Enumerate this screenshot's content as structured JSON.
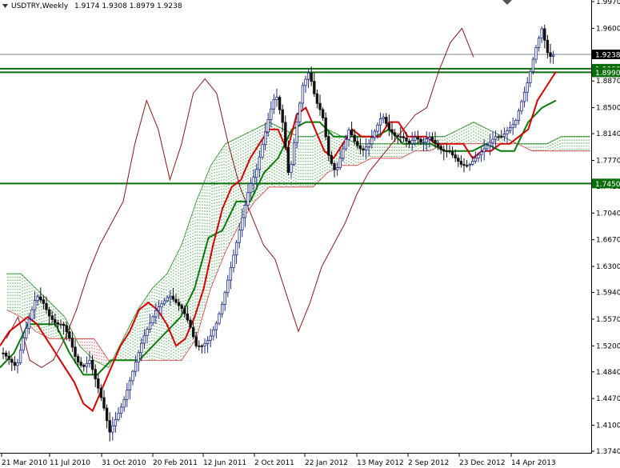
{
  "header": {
    "symbol": "USDTRY,Weekly",
    "ohlc": "1.9174 1.9308 1.8979 1.9238"
  },
  "colors": {
    "candle_up": "#1d2a8a",
    "candle_down": "#111111",
    "tenkan": "#d60000",
    "kijun": "#0a7a0a",
    "chikou": "#8b1a1a",
    "cloud_bull": "#1f8f1f",
    "cloud_bear": "#d63a3a",
    "level_line": "#0a6e0a",
    "current_price_line": "#778899"
  },
  "chart_data": {
    "type": "candlestick",
    "ylim": [
      1.374,
      1.997
    ],
    "y_ticks": [
      "1.9970",
      "1.9600",
      "1.9230",
      "1.8870",
      "1.8500",
      "1.8140",
      "1.7770",
      "1.7410",
      "1.7040",
      "1.6670",
      "1.6300",
      "1.5940",
      "1.5570",
      "1.5200",
      "1.4840",
      "1.4470",
      "1.4100",
      "1.3740"
    ],
    "x_ticks": [
      "21 Mar 2010",
      "11 Jul 2010",
      "31 Oct 2010",
      "20 Feb 2011",
      "12 Jun 2011",
      "2 Oct 2011",
      "22 Jan 2012",
      "13 May 2012",
      "2 Sep 2012",
      "23 Dec 2012",
      "14 Apr 2013"
    ],
    "price_labels": [
      {
        "text": "1.9238",
        "value": 1.9238,
        "style": "current"
      },
      {
        "text": "1.9060",
        "value": 1.904,
        "style": "level"
      },
      {
        "text": "1.8990",
        "value": 1.899,
        "style": "level"
      },
      {
        "text": "1.7450",
        "value": 1.745,
        "style": "level"
      }
    ],
    "horizontal_levels": [
      1.9238,
      1.904,
      1.899,
      1.745
    ],
    "close_path": [
      1.51,
      1.5,
      1.49,
      1.53,
      1.56,
      1.59,
      1.58,
      1.56,
      1.55,
      1.55,
      1.53,
      1.5,
      1.49,
      1.5,
      1.47,
      1.44,
      1.4,
      1.42,
      1.44,
      1.47,
      1.5,
      1.53,
      1.55,
      1.57,
      1.58,
      1.59,
      1.58,
      1.57,
      1.55,
      1.52,
      1.52,
      1.53,
      1.55,
      1.58,
      1.62,
      1.66,
      1.7,
      1.74,
      1.76,
      1.8,
      1.84,
      1.87,
      1.83,
      1.75,
      1.82,
      1.88,
      1.9,
      1.86,
      1.84,
      1.78,
      1.76,
      1.79,
      1.82,
      1.8,
      1.79,
      1.8,
      1.82,
      1.84,
      1.82,
      1.81,
      1.81,
      1.8,
      1.81,
      1.8,
      1.81,
      1.8,
      1.79,
      1.79,
      1.78,
      1.77,
      1.77,
      1.78,
      1.79,
      1.8,
      1.81,
      1.81,
      1.82,
      1.83,
      1.86,
      1.89,
      1.93,
      1.96,
      1.92,
      1.9238
    ],
    "tenkan_path": [
      1.52,
      1.54,
      1.55,
      1.56,
      1.55,
      1.53,
      1.51,
      1.49,
      1.47,
      1.44,
      1.43,
      1.46,
      1.49,
      1.52,
      1.54,
      1.57,
      1.58,
      1.57,
      1.55,
      1.52,
      1.53,
      1.56,
      1.6,
      1.66,
      1.71,
      1.74,
      1.75,
      1.78,
      1.8,
      1.82,
      1.82,
      1.79,
      1.84,
      1.85,
      1.82,
      1.79,
      1.78,
      1.8,
      1.82,
      1.81,
      1.81,
      1.81,
      1.83,
      1.83,
      1.81,
      1.81,
      1.81,
      1.8,
      1.8,
      1.8,
      1.8,
      1.78,
      1.79,
      1.79,
      1.8,
      1.8,
      1.81,
      1.82,
      1.86,
      1.88,
      1.9
    ],
    "kijun_path": [
      1.49,
      1.51,
      1.55,
      1.55,
      1.55,
      1.51,
      1.48,
      1.48,
      1.5,
      1.5,
      1.5,
      1.52,
      1.54,
      1.56,
      1.6,
      1.67,
      1.68,
      1.72,
      1.72,
      1.76,
      1.78,
      1.82,
      1.83,
      1.83,
      1.81,
      1.81,
      1.81,
      1.81,
      1.82,
      1.8,
      1.8,
      1.8,
      1.79,
      1.79,
      1.79,
      1.8,
      1.79,
      1.79,
      1.83,
      1.85,
      1.86
    ],
    "chikou_path": [
      1.53,
      1.56,
      1.5,
      1.49,
      1.5,
      1.53,
      1.57,
      1.62,
      1.66,
      1.69,
      1.72,
      1.8,
      1.86,
      1.82,
      1.75,
      1.8,
      1.87,
      1.89,
      1.87,
      1.8,
      1.74,
      1.7,
      1.66,
      1.64,
      1.59,
      1.54,
      1.58,
      1.63,
      1.66,
      1.69,
      1.73,
      1.76,
      1.78,
      1.8,
      1.82,
      1.84,
      1.85,
      1.9,
      1.94,
      1.96,
      1.92
    ],
    "senkou_a_path": [
      1.62,
      1.62,
      1.6,
      1.58,
      1.56,
      1.52,
      1.5,
      1.49,
      1.53,
      1.57,
      1.6,
      1.62,
      1.66,
      1.72,
      1.77,
      1.8,
      1.81,
      1.82,
      1.83,
      1.82,
      1.81,
      1.81,
      1.82,
      1.81,
      1.8,
      1.8,
      1.8,
      1.8,
      1.8,
      1.81,
      1.81,
      1.82,
      1.83,
      1.82,
      1.81,
      1.8,
      1.8,
      1.8,
      1.81,
      1.81,
      1.81
    ],
    "senkou_b_path": [
      1.57,
      1.56,
      1.54,
      1.53,
      1.53,
      1.53,
      1.53,
      1.5,
      1.5,
      1.5,
      1.5,
      1.5,
      1.5,
      1.53,
      1.6,
      1.65,
      1.69,
      1.72,
      1.74,
      1.74,
      1.74,
      1.74,
      1.76,
      1.77,
      1.77,
      1.78,
      1.78,
      1.78,
      1.79,
      1.79,
      1.8,
      1.8,
      1.8,
      1.8,
      1.8,
      1.8,
      1.79,
      1.79,
      1.79,
      1.79,
      1.79
    ]
  }
}
